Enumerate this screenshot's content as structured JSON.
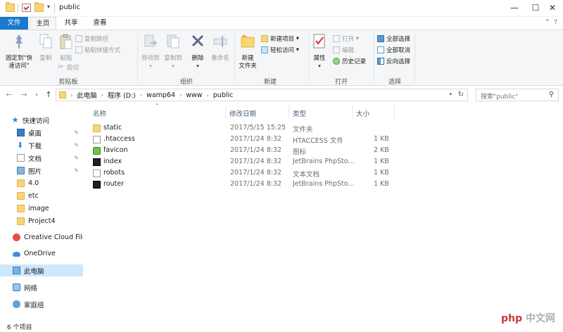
{
  "window": {
    "title": "public"
  },
  "ribbon_tabs": [
    "文件",
    "主页",
    "共享",
    "查看"
  ],
  "ribbon": {
    "clipboard": {
      "pin": "固定到\"快\n速访问\"",
      "copy": "复制",
      "paste": "粘贴",
      "copy_path": "复制路径",
      "paste_shortcut": "粘贴快捷方式",
      "cut": "剪切",
      "label": "剪贴板"
    },
    "organize": {
      "move_to": "移动到",
      "copy_to": "复制到",
      "delete": "删除",
      "rename": "重命名",
      "label": "组织"
    },
    "new": {
      "new_folder": "新建\n文件夹",
      "new_item": "新建项目",
      "easy_access": "轻松访问",
      "label": "新建"
    },
    "open": {
      "properties": "属性",
      "open": "打开",
      "edit": "编辑",
      "history": "历史记录",
      "label": "打开"
    },
    "select": {
      "select_all": "全部选择",
      "select_none": "全部取消",
      "invert": "反向选择",
      "label": "选择"
    }
  },
  "address": {
    "crumbs": [
      "此电脑",
      "程序 (D:)",
      "wamp64",
      "www",
      "public"
    ],
    "search_placeholder": "搜索\"public\""
  },
  "sidebar": {
    "items": [
      {
        "label": "快速访问",
        "icon": "star-icon",
        "pinned": false
      },
      {
        "label": "桌面",
        "icon": "desktop-icon",
        "pinned": true
      },
      {
        "label": "下载",
        "icon": "download-icon",
        "pinned": true
      },
      {
        "label": "文档",
        "icon": "document-icon",
        "pinned": true
      },
      {
        "label": "图片",
        "icon": "picture-icon",
        "pinned": true
      },
      {
        "label": "4.0",
        "icon": "folder-icon",
        "pinned": false
      },
      {
        "label": "etc",
        "icon": "folder-icon",
        "pinned": false
      },
      {
        "label": "image",
        "icon": "folder-icon",
        "pinned": false
      },
      {
        "label": "Project4",
        "icon": "folder-icon",
        "pinned": false
      },
      {
        "label": "Creative Cloud Files",
        "icon": "creative-cloud-icon",
        "pinned": false
      },
      {
        "label": "OneDrive",
        "icon": "onedrive-icon",
        "pinned": false
      },
      {
        "label": "此电脑",
        "icon": "this-pc-icon",
        "pinned": false
      },
      {
        "label": "网络",
        "icon": "network-icon",
        "pinned": false
      },
      {
        "label": "家庭组",
        "icon": "homegroup-icon",
        "pinned": false
      }
    ]
  },
  "columns": {
    "name": "名称",
    "date": "修改日期",
    "type": "类型",
    "size": "大小"
  },
  "files": [
    {
      "name": "static",
      "date": "2017/5/15 15:25",
      "type": "文件夹",
      "size": "",
      "icon": "folder-icon"
    },
    {
      "name": ".htaccess",
      "date": "2017/1/24 8:32",
      "type": "HTACCESS 文件",
      "size": "1 KB",
      "icon": "file-icon"
    },
    {
      "name": "favicon",
      "date": "2017/1/24 8:32",
      "type": "图标",
      "size": "2 KB",
      "icon": "favicon-icon"
    },
    {
      "name": "index",
      "date": "2017/1/24 8:32",
      "type": "JetBrains PhpSto...",
      "size": "1 KB",
      "icon": "phpstorm-icon"
    },
    {
      "name": "robots",
      "date": "2017/1/24 8:32",
      "type": "文本文档",
      "size": "1 KB",
      "icon": "text-file-icon"
    },
    {
      "name": "router",
      "date": "2017/1/24 8:32",
      "type": "JetBrains PhpSto...",
      "size": "1 KB",
      "icon": "phpstorm-icon"
    }
  ],
  "status": {
    "count": "6 个项目"
  },
  "watermark": {
    "logo": "php",
    "text": "中文网"
  }
}
